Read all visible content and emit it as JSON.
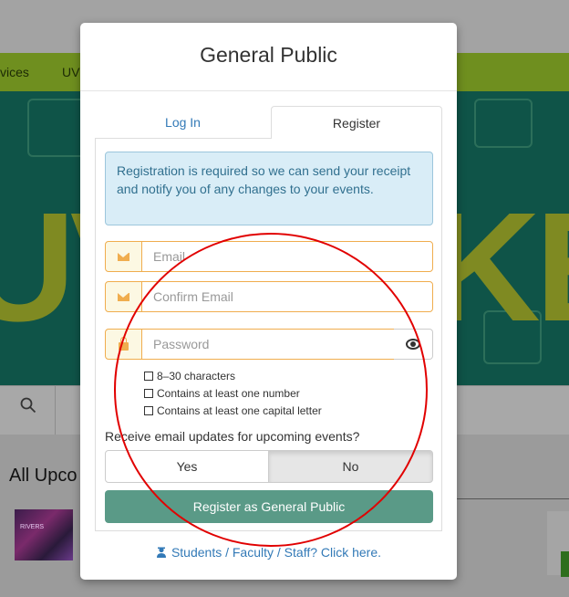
{
  "background": {
    "nav_items": [
      "vices",
      "UV"
    ],
    "banner_left_text": "UV",
    "banner_right_text": "KET",
    "list_title": "All Upco",
    "thumb_text": "RIVERS"
  },
  "modal": {
    "title": "General Public",
    "tabs": {
      "login": "Log In",
      "register": "Register"
    },
    "alert": "Registration is required so we can send your receipt and notify you of any changes to your events.",
    "email": {
      "placeholder": "Email"
    },
    "confirm_email": {
      "placeholder": "Confirm Email"
    },
    "password": {
      "placeholder": "Password"
    },
    "rules": [
      "8–30 characters",
      "Contains at least one number",
      "Contains at least one capital letter"
    ],
    "updates_question": "Receive email updates for upcoming events?",
    "updates_options": {
      "yes": "Yes",
      "no": "No",
      "selected": "No"
    },
    "submit_label": "Register as General Public",
    "footer_link": "Students / Faculty / Staff? Click here."
  },
  "colors": {
    "accent": "#337ab7",
    "warning_border": "#f0ad4e",
    "submit_bg": "#5a9a87",
    "annotation": "#e10000"
  },
  "icons": {
    "email_addon": "envelope-icon",
    "password_addon": "lock-icon",
    "show_password": "eye-icon",
    "footer": "graduation-cap-icon",
    "search": "search-icon"
  }
}
